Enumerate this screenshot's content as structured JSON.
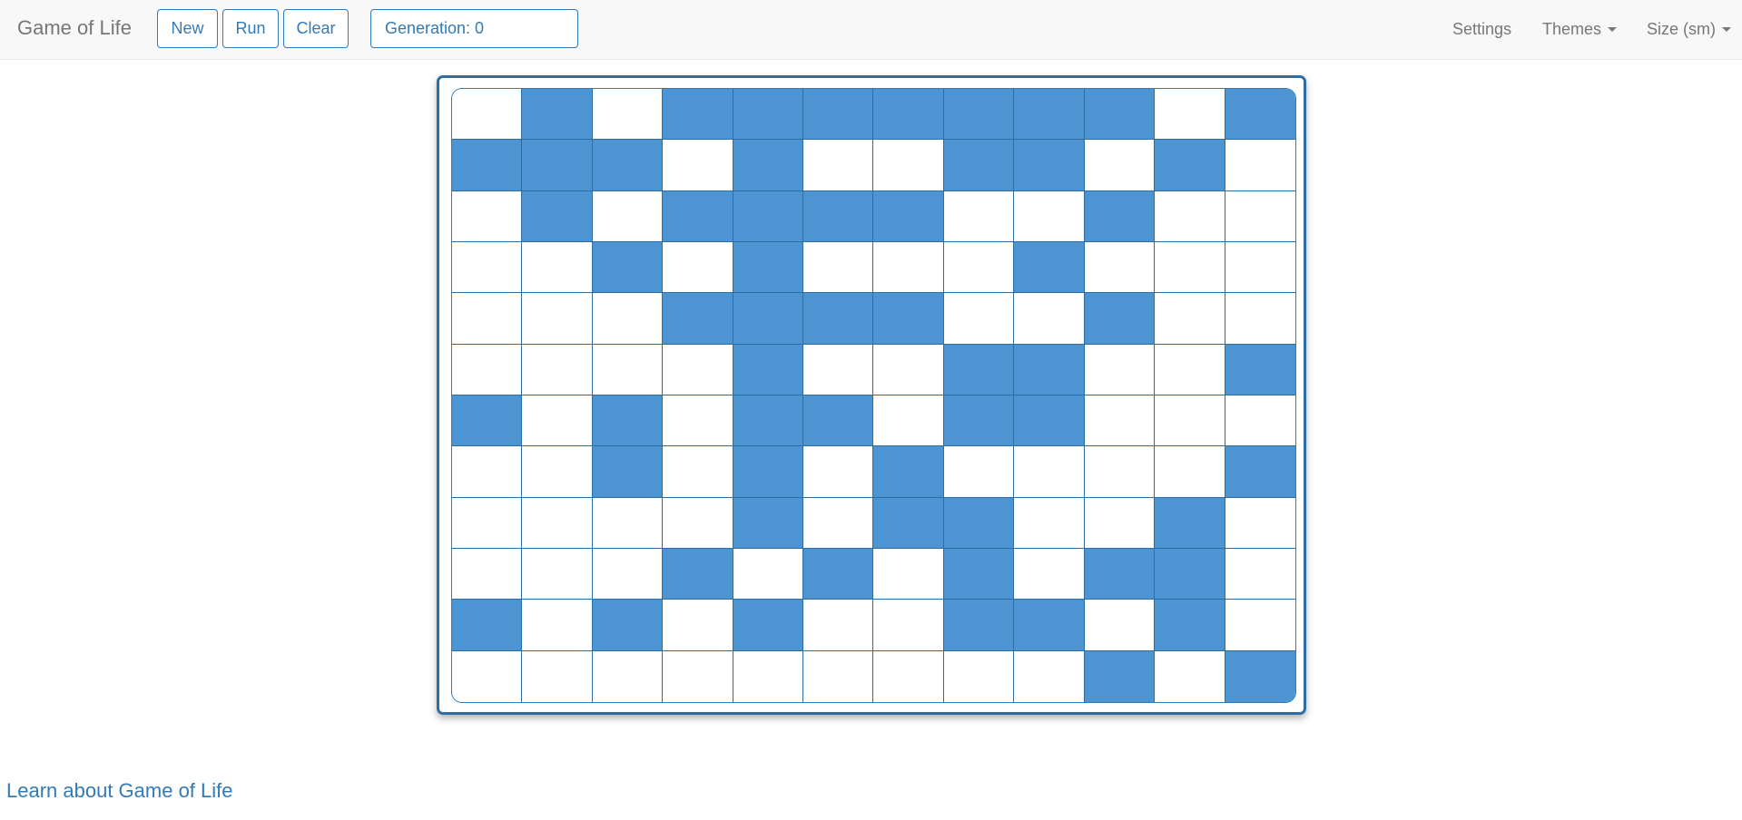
{
  "navbar": {
    "brand": "Game of Life",
    "buttons": {
      "new": "New",
      "run": "Run",
      "clear": "Clear"
    },
    "generation": "Generation: 0",
    "settings": "Settings",
    "themes": "Themes",
    "size": "Size (sm)"
  },
  "board": {
    "rows": 12,
    "cols": 12,
    "alive_color": "#4d94d2",
    "dead_color": "#ffffff",
    "border_color": "#2e6da4",
    "cells": [
      [
        0,
        1,
        0,
        1,
        1,
        1,
        1,
        1,
        1,
        1,
        0,
        1
      ],
      [
        1,
        1,
        1,
        0,
        1,
        0,
        0,
        1,
        1,
        0,
        1,
        0
      ],
      [
        0,
        1,
        0,
        1,
        1,
        1,
        1,
        0,
        0,
        1,
        0,
        0
      ],
      [
        0,
        0,
        1,
        0,
        1,
        0,
        0,
        0,
        1,
        0,
        0,
        0
      ],
      [
        0,
        0,
        0,
        1,
        1,
        1,
        1,
        0,
        0,
        1,
        0,
        0
      ],
      [
        0,
        0,
        0,
        0,
        1,
        0,
        0,
        1,
        1,
        0,
        0,
        1
      ],
      [
        1,
        0,
        1,
        0,
        1,
        1,
        0,
        1,
        1,
        0,
        0,
        0
      ],
      [
        0,
        0,
        1,
        0,
        1,
        0,
        1,
        0,
        0,
        0,
        0,
        1
      ],
      [
        0,
        0,
        0,
        0,
        1,
        0,
        1,
        1,
        0,
        0,
        1,
        0
      ],
      [
        0,
        0,
        0,
        1,
        0,
        1,
        0,
        1,
        0,
        1,
        1,
        0
      ],
      [
        1,
        0,
        1,
        0,
        1,
        0,
        0,
        1,
        1,
        0,
        1,
        0
      ],
      [
        0,
        0,
        0,
        0,
        0,
        0,
        0,
        0,
        0,
        1,
        0,
        1
      ]
    ]
  },
  "footer": {
    "learn_link": "Learn about Game of Life"
  }
}
